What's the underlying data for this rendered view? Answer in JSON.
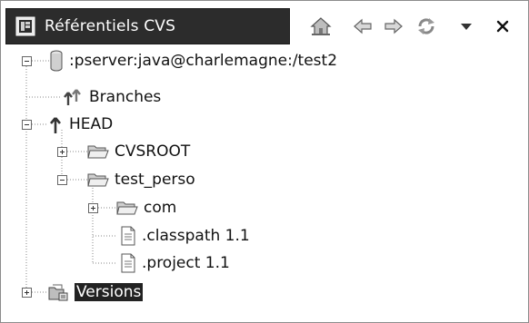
{
  "panel": {
    "title": "Référentiels CVS",
    "toolbar": [
      {
        "name": "home-icon"
      },
      {
        "name": "back-arrow-icon"
      },
      {
        "name": "forward-arrow-icon"
      },
      {
        "name": "refresh-icon"
      },
      {
        "name": "view-menu-icon"
      },
      {
        "name": "close-icon"
      }
    ]
  },
  "tree": {
    "repository": ":pserver:java@charlemagne:/test2",
    "branches": "Branches",
    "head": "HEAD",
    "cvsroot": "CVSROOT",
    "test_perso": "test_perso",
    "com": "com",
    "classpath": ".classpath 1.1",
    "project": ".project 1.1",
    "versions": "Versions"
  }
}
